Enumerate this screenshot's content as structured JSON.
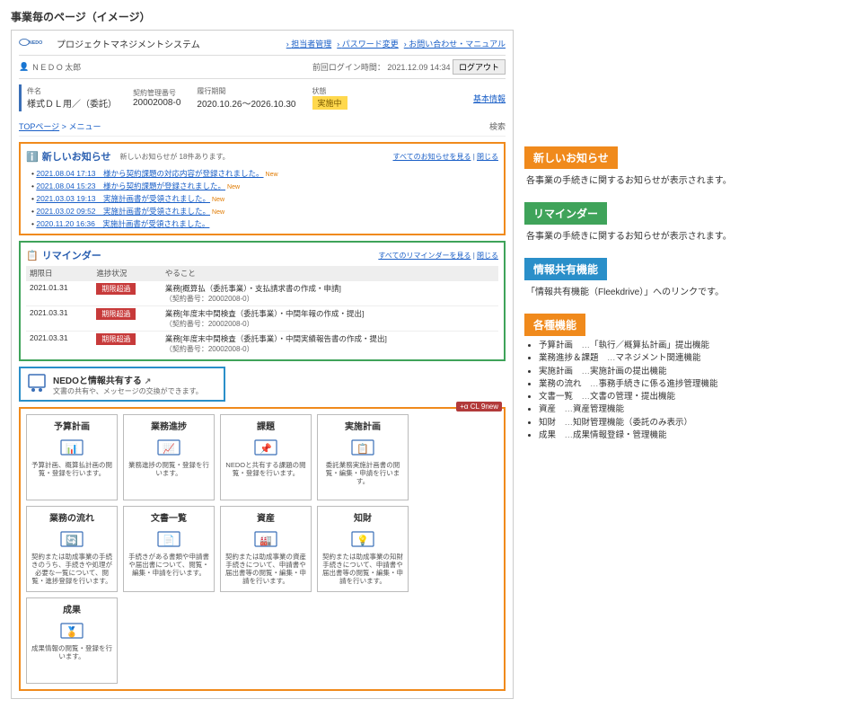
{
  "page_title": "事業毎のページ（イメージ）",
  "header": {
    "logo_text": "NEDO",
    "app_name": "プロジェクトマネジメントシステム",
    "links": [
      "担当者管理",
      "パスワード変更",
      "お問い合わせ・マニュアル"
    ]
  },
  "userbar": {
    "user_icon": "👤",
    "user_name": "N E D O  太郎",
    "last_login_label": "前回ログイン時間：",
    "last_login": "2021.12.09 14:34",
    "logout": "ログアウト"
  },
  "contract": {
    "name_lbl": "件名",
    "name": "様式ＤＬ用／（委託）",
    "mgmt_lbl": "契約管理番号",
    "mgmt_no": "20002008-0",
    "period_lbl": "履行期間",
    "period": "2020.10.26～2026.10.30",
    "status_lbl": "状態",
    "status": "実施中",
    "basic_link": "基本情報"
  },
  "breadcrumb": {
    "top": "TOPページ",
    "sep": " > ",
    "cur": "メニュー"
  },
  "search_label": "検索",
  "oshiraze": {
    "title": "新しいお知らせ",
    "sub": "新しいお知らせが 18件あります。",
    "link_all": "すべてのお知らせを見る",
    "link_close": "閉じる",
    "items": [
      {
        "ts": "2021.08.04 17:13",
        "txt": "様から契約課題の対応内容が登録されました。",
        "new": "New"
      },
      {
        "ts": "2021.08.04 15:23",
        "txt": "様から契約課題が登録されました。",
        "new": "New"
      },
      {
        "ts": "2021.03.03 19:13",
        "txt": "実施計画書が受領されました。",
        "new": "New"
      },
      {
        "ts": "2021.03.02 09:52",
        "txt": "実施計画書が受領されました。",
        "new": "New"
      },
      {
        "ts": "2020.11.20 16:36",
        "txt": "実施計画書が受領されました。",
        "new": ""
      }
    ]
  },
  "reminder": {
    "title": "リマインダー",
    "link_all": "すべてのリマインダーを見る",
    "link_close": "閉じる",
    "th": {
      "date": "期限日",
      "status": "進捗状況",
      "todo": "やること"
    },
    "rows": [
      {
        "date": "2021.01.31",
        "badge": "期限超過",
        "todo": "業務[概算払（委託事業）・支払請求書の作成・申請]",
        "sub": "（契約番号：20002008-0）"
      },
      {
        "date": "2021.03.31",
        "badge": "期限超過",
        "todo": "業務[年度末中間検査（委託事業）・中間年報の作成・提出]",
        "sub": "（契約番号：20002008-0）"
      },
      {
        "date": "2021.03.31",
        "badge": "期限超過",
        "todo": "業務[年度末中間検査（委託事業）・中間実績報告書の作成・提出]",
        "sub": "（契約番号：20002008-0）"
      }
    ]
  },
  "share": {
    "title": "NEDOと情報共有する",
    "sub": "文書の共有や、メッセージの交換ができます。",
    "ext": "↗"
  },
  "badge_text": "+α CL 9new",
  "cards": [
    {
      "ttl": "予算計画",
      "desc": "予算計画、概算払計画の閲覧・登録を行います。"
    },
    {
      "ttl": "業務進捗",
      "desc": "業務進捗の閲覧・登録を行います。"
    },
    {
      "ttl": "課題",
      "desc": "NEDOと共有する課題の閲覧・登録を行います。"
    },
    {
      "ttl": "実施計画",
      "desc": "委託業務実施計画書の閲覧・編集・申請を行います。"
    },
    {
      "ttl": "業務の流れ",
      "desc": "契約または助成事業の手続きのうち、手続きや処理が必要な一覧について、閲覧・進捗登録を行います。"
    },
    {
      "ttl": "文書一覧",
      "desc": "手続きがある書類や申請書や届出書について、閲覧・編集・申請を行います。"
    },
    {
      "ttl": "資産",
      "desc": "契約または助成事業の資産手続きについて、申請書や届出書等の閲覧・編集・申請を行います。"
    },
    {
      "ttl": "知財",
      "desc": "契約または助成事業の知財手続きについて、申請書や届出書等の閲覧・編集・申請を行います。"
    },
    {
      "ttl": "成果",
      "desc": "成果情報の閲覧・登録を行います。"
    }
  ],
  "callouts": {
    "c1": {
      "hdr": "新しいお知らせ",
      "body": "各事業の手続きに関するお知らせが表示されます。"
    },
    "c2": {
      "hdr": "リマインダー",
      "body": "各事業の手続きに関するお知らせが表示されます。"
    },
    "c3": {
      "hdr": "情報共有機能",
      "body": "「情報共有機能（Fleekdrive）」へのリンクです。"
    },
    "c4": {
      "hdr": "各種機能",
      "list": [
        {
          "name": "予算計画",
          "desc": "「執行／概算払計画」提出機能"
        },
        {
          "name": "業務進捗＆課題",
          "desc": "マネジメント関連機能"
        },
        {
          "name": "実施計画",
          "desc": "実施計画の提出機能"
        },
        {
          "name": "業務の流れ",
          "desc": "事務手続きに係る進捗管理機能"
        },
        {
          "name": "文書一覧",
          "desc": "文書の管理・提出機能"
        },
        {
          "name": "資産",
          "desc": "資産管理機能"
        },
        {
          "name": "知財",
          "desc": "知財管理機能（委託のみ表示）"
        },
        {
          "name": "成果",
          "desc": "成果情報登録・管理機能"
        }
      ]
    }
  }
}
